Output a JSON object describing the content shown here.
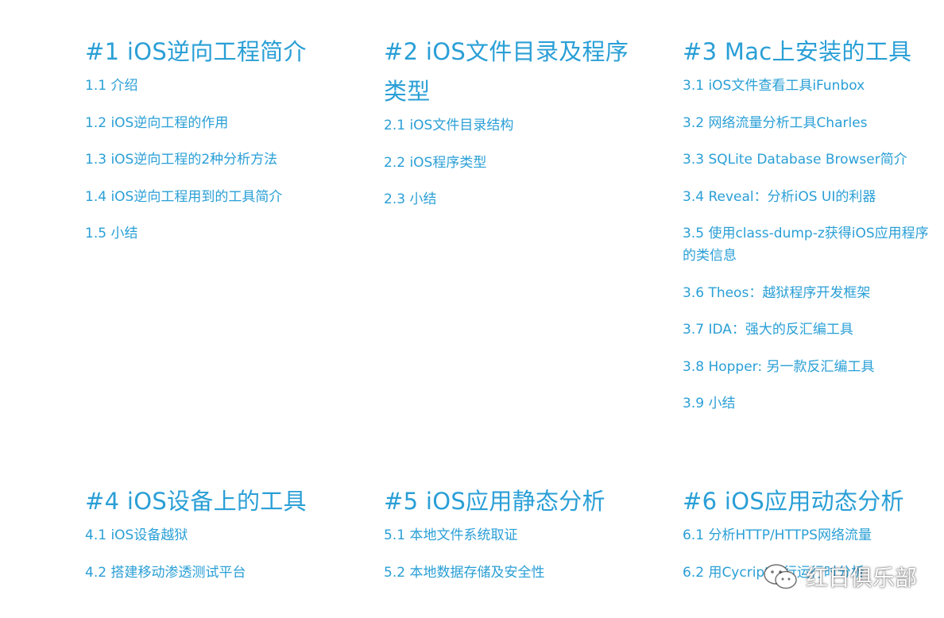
{
  "sections": [
    {
      "title": "#1 iOS逆向工程简介",
      "items": [
        "1.1 介绍",
        "1.2 iOS逆向工程的作用",
        "1.3 iOS逆向工程的2种分析方法",
        "1.4 iOS逆向工程用到的工具简介",
        "1.5 小结"
      ]
    },
    {
      "title": "#2 iOS文件目录及程序类型",
      "items": [
        "2.1 iOS文件目录结构",
        "2.2 iOS程序类型",
        "2.3 小结"
      ]
    },
    {
      "title": "#3 Mac上安装的工具",
      "items": [
        "3.1 iOS文件查看工具iFunbox",
        "3.2 网络流量分析工具Charles",
        "3.3 SQLite Database Browser简介",
        "3.4 Reveal：分析iOS UI的利器",
        "3.5 使用class-dump-z获得iOS应用程序的类信息",
        "3.6 Theos：越狱程序开发框架",
        "3.7 IDA：强大的反汇编工具",
        "3.8 Hopper: 另一款反汇编工具",
        "3.9 小结"
      ]
    },
    {
      "title": "#4 iOS设备上的工具",
      "items": [
        "4.1 iOS设备越狱",
        "4.2 搭建移动渗透测试平台"
      ]
    },
    {
      "title": "#5 iOS应用静态分析",
      "items": [
        "5.1 本地文件系统取证",
        "5.2 本地数据存储及安全性"
      ]
    },
    {
      "title": "#6 iOS应用动态分析",
      "items": [
        "6.1 分析HTTP/HTTPS网络流量",
        "6.2 用Cycript进行运行时分析"
      ]
    }
  ],
  "watermark": {
    "text": "红日俱乐部",
    "icon": "wechat-icon"
  },
  "colors": {
    "accent": "#2a9fd6",
    "background": "#ffffff"
  }
}
